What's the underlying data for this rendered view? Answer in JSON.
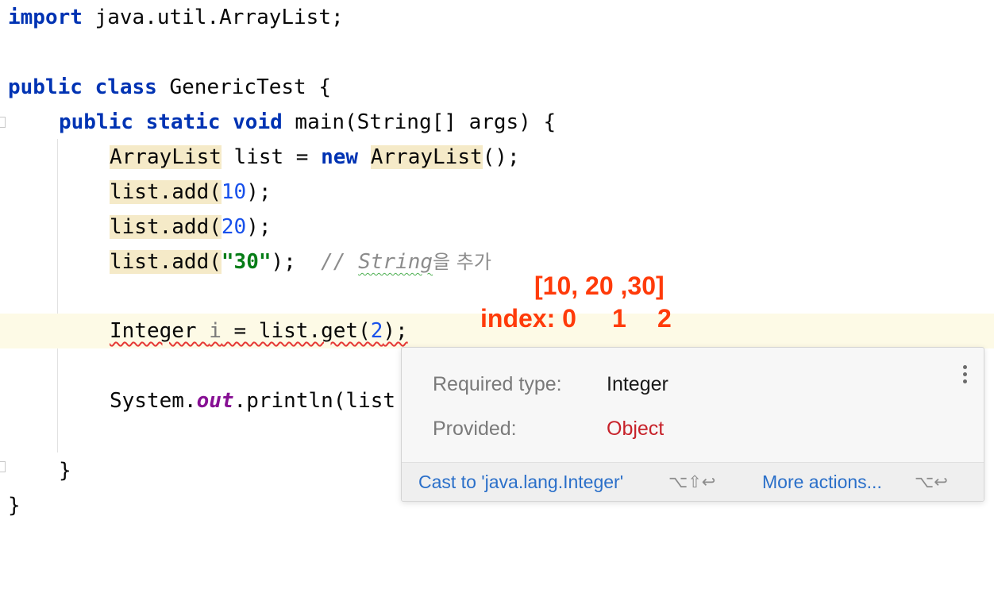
{
  "code": {
    "import_kw": "import",
    "import_path": " java.util.ArrayList;",
    "class_kw": "public class",
    "class_rest": " GenericTest {",
    "method_kw1": "public static void",
    "method_rest": " main(String[] args) {",
    "decl_type": "ArrayList",
    "decl_mid": " list = ",
    "decl_new": "new",
    "decl_type2": "ArrayList",
    "decl_end": "();",
    "add1_pre": "list.add(",
    "add1_num": "10",
    "add1_post": ");",
    "add2_pre": "list.add(",
    "add2_num": "20",
    "add2_post": ");",
    "add3_pre": "list.add(",
    "add3_str": "\"30\"",
    "add3_post": ");",
    "add3_comment_slashes": "// ",
    "add3_comment_string": "String",
    "add3_comment_korean": "을 추가",
    "get_type": "Integer",
    "get_var": "i",
    "get_mid": " = list.get(",
    "get_num": "2",
    "get_end": ");",
    "print_pre": "System.",
    "print_field": "out",
    "print_post": ".println(list",
    "close_method": "}",
    "close_class": "}"
  },
  "annotation": {
    "list_text": "[10, 20 ,30]",
    "index_label": "index: 0",
    "index_1": "1",
    "index_2": "2",
    "color": "#ff3b0a"
  },
  "popup": {
    "required_label": "Required type:",
    "required_value": "Integer",
    "provided_label": "Provided:",
    "provided_value": "Object",
    "menu_icon": "more-vertical-icon",
    "action_cast": "Cast to 'java.lang.Integer'",
    "action_cast_shortcut": "⌥⇧↩",
    "action_more": "More actions...",
    "action_more_shortcut": "⌥↩"
  }
}
